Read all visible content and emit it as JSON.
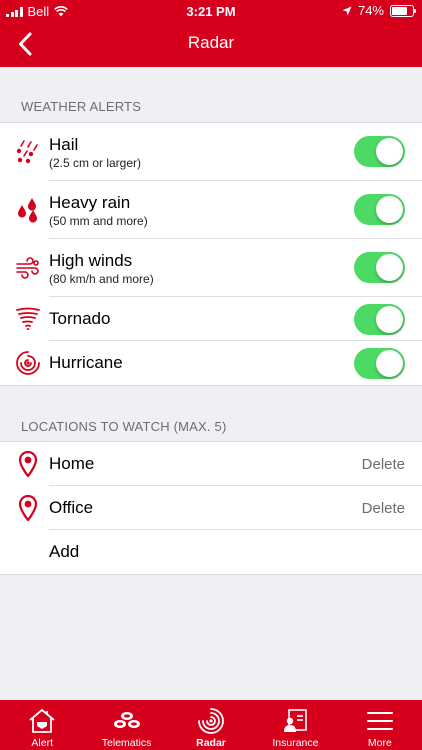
{
  "status_bar": {
    "carrier": "Bell",
    "time": "3:21 PM",
    "battery": "74%",
    "battery_level": 0.74
  },
  "nav": {
    "title": "Radar",
    "back_icon": "chevron-left-icon"
  },
  "weather_alerts": {
    "header": "WEATHER ALERTS",
    "items": [
      {
        "label": "Hail",
        "sublabel": "(2.5 cm or larger)",
        "icon": "hail-icon",
        "enabled": true
      },
      {
        "label": "Heavy rain",
        "sublabel": "(50 mm and more)",
        "icon": "rain-drops-icon",
        "enabled": true
      },
      {
        "label": "High winds",
        "sublabel": "(80 km/h and more)",
        "icon": "wind-icon",
        "enabled": true
      },
      {
        "label": "Tornado",
        "sublabel": "",
        "icon": "tornado-icon",
        "enabled": true
      },
      {
        "label": "Hurricane",
        "sublabel": "",
        "icon": "hurricane-icon",
        "enabled": true
      }
    ]
  },
  "locations": {
    "header": "LOCATIONS TO WATCH (MAX. 5)",
    "items": [
      {
        "label": "Home",
        "action": "Delete",
        "icon": "location-pin-icon"
      },
      {
        "label": "Office",
        "action": "Delete",
        "icon": "location-pin-icon"
      }
    ],
    "add_label": "Add"
  },
  "tabbar": {
    "tabs": [
      {
        "label": "Alert",
        "icon": "house-alert-icon",
        "active": false
      },
      {
        "label": "Telematics",
        "icon": "telematics-icon",
        "active": false
      },
      {
        "label": "Radar",
        "icon": "radar-icon",
        "active": true
      },
      {
        "label": "Insurance",
        "icon": "insurance-card-icon",
        "active": false
      },
      {
        "label": "More",
        "icon": "menu-icon",
        "active": false
      }
    ]
  },
  "colors": {
    "brand_red": "#d6001c",
    "toggle_on": "#4cd964",
    "background": "#efeff4"
  }
}
